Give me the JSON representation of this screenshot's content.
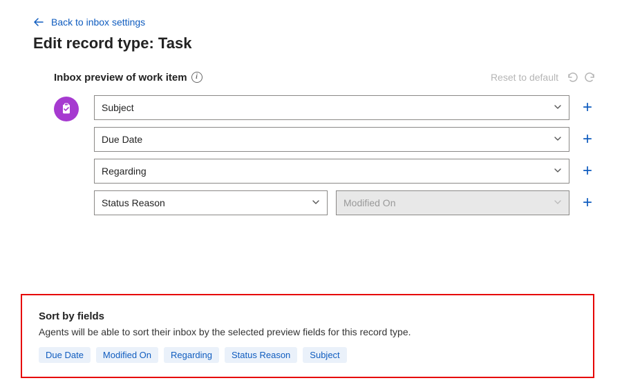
{
  "nav": {
    "back_label": "Back to inbox settings"
  },
  "page_title": "Edit record type: Task",
  "preview": {
    "heading": "Inbox preview of work item",
    "reset_label": "Reset to default",
    "rows": [
      {
        "primary": "Subject"
      },
      {
        "primary": "Due Date"
      },
      {
        "primary": "Regarding"
      },
      {
        "primary": "Status Reason",
        "secondary": "Modified On",
        "secondary_disabled": true
      }
    ]
  },
  "sort": {
    "title": "Sort by fields",
    "description": "Agents will be able to sort their inbox by the selected preview fields for this record type.",
    "chips": [
      "Due Date",
      "Modified On",
      "Regarding",
      "Status Reason",
      "Subject"
    ]
  }
}
